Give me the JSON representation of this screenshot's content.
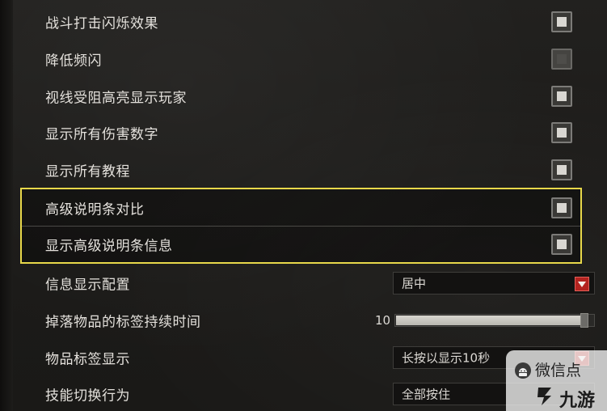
{
  "settings": {
    "combat_flash": {
      "label": "战斗打击闪烁效果",
      "checked": true
    },
    "reduce_flash": {
      "label": "降低频闪",
      "checked": false
    },
    "highlight_blocked": {
      "label": "视线受阻高亮显示玩家",
      "checked": true
    },
    "show_damage": {
      "label": "显示所有伤害数字",
      "checked": true
    },
    "show_tutorials": {
      "label": "显示所有教程",
      "checked": true
    },
    "advanced_tooltip_contrast": {
      "label": "高级说明条对比",
      "checked": true
    },
    "show_advanced_tooltip": {
      "label": "显示高级说明条信息",
      "checked": true
    },
    "info_display": {
      "label": "信息显示配置",
      "value": "居中"
    },
    "drop_label_duration": {
      "label": "掉落物品的标签持续时间",
      "value": "10",
      "fraction": 0.97
    },
    "item_label_display": {
      "label": "物品标签显示",
      "value": "长按以显示10秒"
    },
    "skill_switch": {
      "label": "技能切换行为",
      "value": "全部按住"
    }
  },
  "watermark": {
    "title": "微信点",
    "brand": "九游"
  },
  "colors": {
    "highlight_border": "#e8d84a",
    "dropdown_arrow": "#b3231f"
  }
}
